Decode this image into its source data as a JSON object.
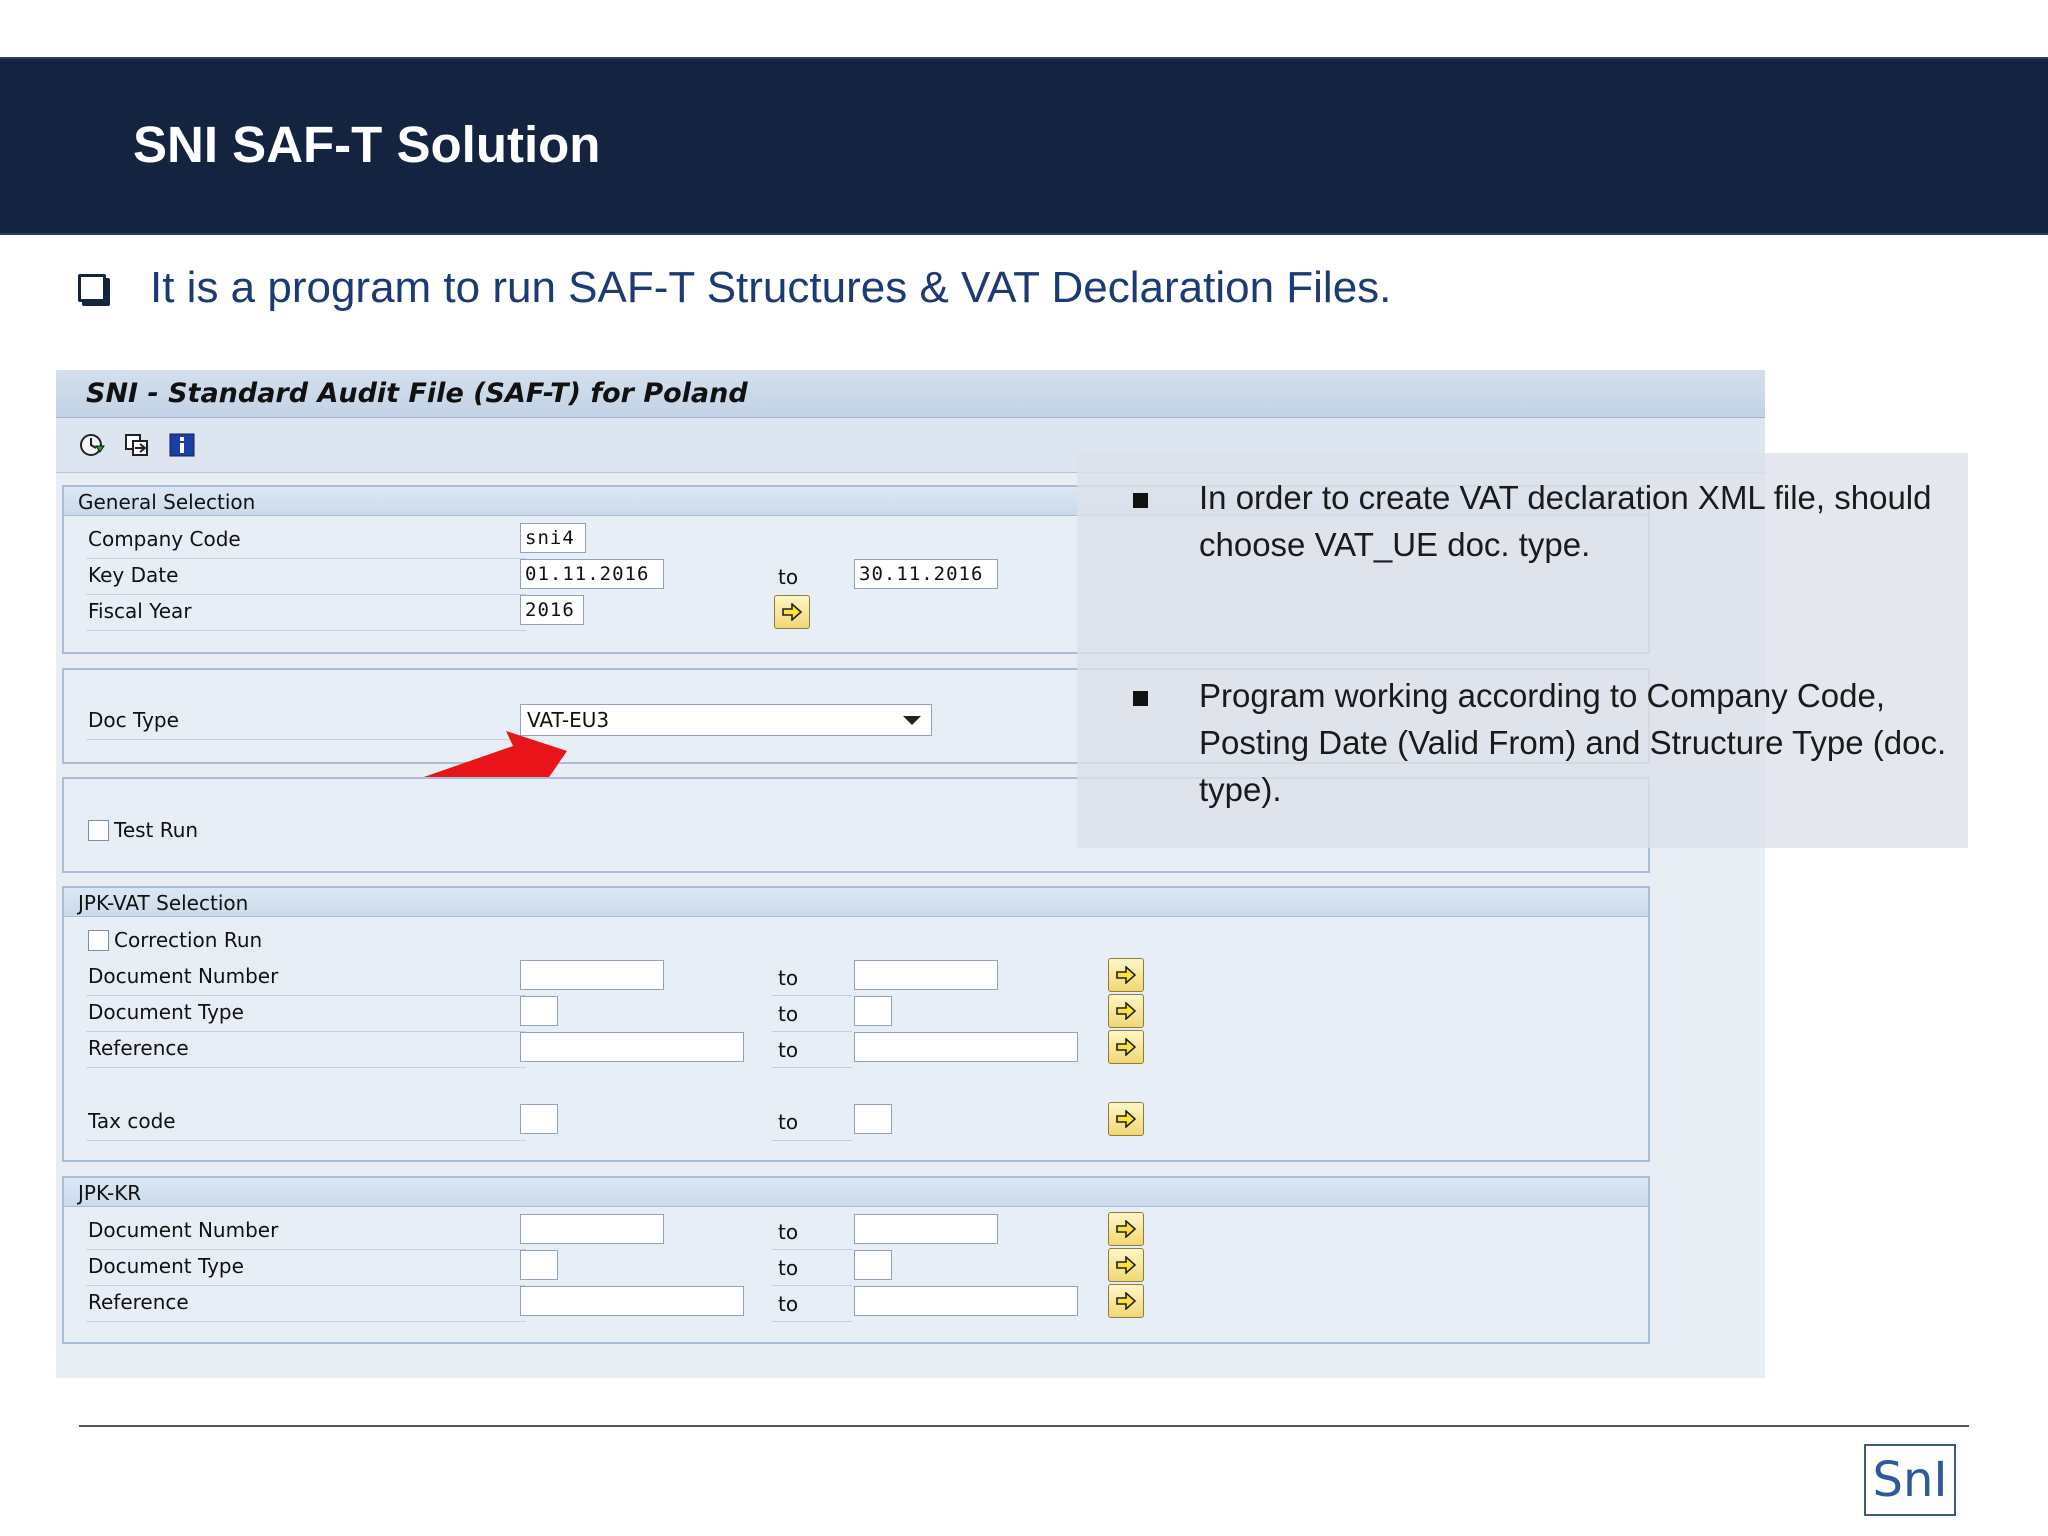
{
  "header": {
    "title": "SNI SAF-T Solution"
  },
  "intro": {
    "text": "It is a program to run SAF-T Structures & VAT Declaration Files."
  },
  "sap": {
    "window_title": "SNI - Standard Audit File (SAF-T) for Poland",
    "toolbar": {
      "icons": [
        "execute-icon",
        "get-variant-icon",
        "info-icon"
      ]
    },
    "general_selection": {
      "title": "General Selection",
      "company_code": {
        "label": "Company Code",
        "value": "sni4"
      },
      "key_date": {
        "label": "Key Date",
        "from": "01.11.2016",
        "to_label": "to",
        "to": "30.11.2016"
      },
      "fiscal_year": {
        "label": "Fiscal Year",
        "value": "2016"
      }
    },
    "doc_type": {
      "label": "Doc Type",
      "value": "VAT-EU3"
    },
    "test_run": {
      "label": "Test Run"
    },
    "jpk_vat": {
      "title": "JPK-VAT Selection",
      "correction_run": "Correction Run",
      "rows": [
        {
          "label": "Document Number",
          "to_label": "to"
        },
        {
          "label": "Document Type",
          "to_label": "to"
        },
        {
          "label": "Reference",
          "to_label": "to"
        },
        {
          "label": "Tax code",
          "to_label": "to"
        }
      ]
    },
    "jpk_kr": {
      "title": "JPK-KR",
      "rows": [
        {
          "label": "Document Number",
          "to_label": "to"
        },
        {
          "label": "Document Type",
          "to_label": "to"
        },
        {
          "label": "Reference",
          "to_label": "to"
        }
      ]
    }
  },
  "notes": {
    "bullet1": "In order to create VAT declaration XML file, should choose VAT_UE doc. type.",
    "bullet2": "Program working according to Company Code, Posting Date (Valid From) and Structure Type (doc. type)."
  },
  "footer": {
    "logo": "SnI"
  },
  "colors": {
    "header_bg": "#142440",
    "intro_text": "#1c3a73",
    "pointer_arrow": "#e8141a"
  }
}
